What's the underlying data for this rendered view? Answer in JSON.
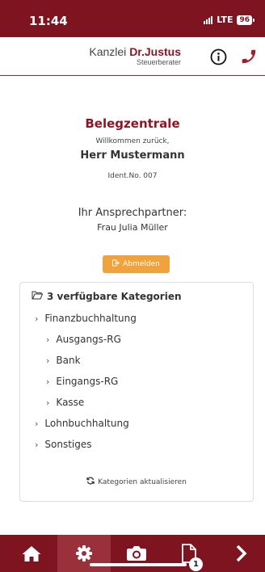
{
  "status_bar": {
    "time": "11:44",
    "network": "LTE",
    "battery": "96"
  },
  "header": {
    "brand_prefix": "Kanzlei ",
    "brand_name": "Dr.Justus",
    "brand_sub": "Steuerberater",
    "icons": [
      "info-icon",
      "phone-icon"
    ],
    "accent_color": "#8b1626"
  },
  "main": {
    "title": "Belegzentrale",
    "welcome": "Willkommen zurück,",
    "user_name": "Herr Mustermann",
    "ident": "Ident.No. 007",
    "contact_heading": "Ihr Ansprechpartner:",
    "contact_name": "Frau Julia Müller",
    "logout_label": "Abmelden",
    "logout_color": "#f0a23c"
  },
  "categories": {
    "heading": "3 verfügbare Kategorien",
    "items": [
      {
        "label": "Finanzbuchhaltung",
        "level": 0
      },
      {
        "label": "Ausgangs-RG",
        "level": 1
      },
      {
        "label": "Bank",
        "level": 1
      },
      {
        "label": "Eingangs-RG",
        "level": 1
      },
      {
        "label": "Kasse",
        "level": 1
      },
      {
        "label": "Lohnbuchhaltung",
        "level": 0
      },
      {
        "label": "Sonstiges",
        "level": 0
      }
    ],
    "refresh_label": "Kategorien aktualisieren"
  },
  "tabbar": {
    "tabs": [
      "home-icon",
      "settings-icon",
      "camera-icon",
      "document-icon",
      "chevron-right-icon"
    ],
    "active": "settings-icon",
    "document_badge": "1"
  }
}
